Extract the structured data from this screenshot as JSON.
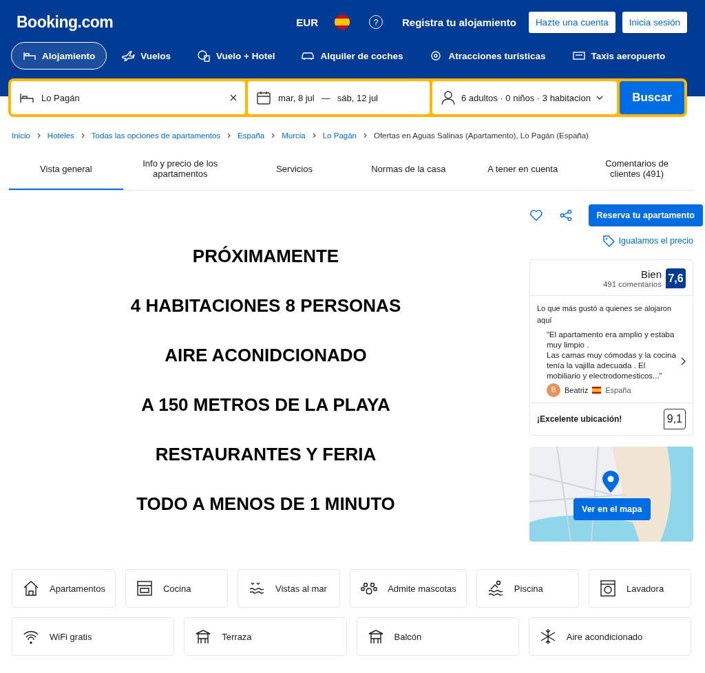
{
  "header": {
    "logo": "Booking.com",
    "currency": "EUR",
    "help": "?",
    "register_link": "Registra tu alojamiento",
    "buttons": [
      "Hazte una cuenta",
      "Inicia sesión"
    ]
  },
  "nav": [
    {
      "label": "Alojamiento",
      "selected": true
    },
    {
      "label": "Vuelos",
      "selected": false
    },
    {
      "label": "Vuelo + Hotel",
      "selected": false
    },
    {
      "label": "Alquiler de coches",
      "selected": false
    },
    {
      "label": "Atracciones turísticas",
      "selected": false
    },
    {
      "label": "Taxis aeropuerto",
      "selected": false
    }
  ],
  "search": {
    "destination": "Lo Pagán",
    "check_in": "mar, 8 jul",
    "dash": "—",
    "check_out": "sáb, 12 jul",
    "guests": "6 adultos · 0 niños · 3 habitacion",
    "button": "Buscar"
  },
  "breadcrumb": {
    "links": [
      "Inicio",
      "Hoteles",
      "Todas las opciones de apartamentos",
      "España",
      "Murcia",
      "Lo Pagán"
    ],
    "current": "Ofertas en Aguas Salinas (Apartamento), Lo Pagán (España)"
  },
  "tabs": [
    {
      "label": "Vista general",
      "selected": true
    },
    {
      "label": "Info y precio de los apartamentos",
      "selected": false
    },
    {
      "label": "Servicios",
      "selected": false
    },
    {
      "label": "Normas de la casa",
      "selected": false
    },
    {
      "label": "A tener en cuenta",
      "selected": false
    },
    {
      "label": "Comentarios de clientes (491)",
      "selected": false
    }
  ],
  "actions": {
    "reserve": "Reserva tu apartamento",
    "price_match": "Igualamos el precio"
  },
  "listing_image_text": [
    "PRÓXIMAMENTE",
    "4 HABITACIONES 8 PERSONAS",
    "AIRE ACONIDCIONADO",
    "A 150 METROS DE LA PLAYA",
    "RESTAURANTES Y FERIA",
    "TODO A MENOS DE 1 MINUTO"
  ],
  "review": {
    "rating_word": "Bien",
    "count": "491 comentarios",
    "score": "7,6",
    "heading": "Lo que más gustó a quienes se alojaron aquí",
    "quote": "“El apartamento era amplio y estaba muy limpio .\nLas camas muy cómodas y la cocina tenía la vajilla adecuada . El mobiliario y electrodomesticos...”",
    "avatar": "B",
    "reviewer": "Beatriz",
    "country": "España",
    "location_label": "¡Excelente ubicación!",
    "location_score": "9,1"
  },
  "map": {
    "button": "Ver en el mapa"
  },
  "amenities": [
    [
      "Apartamentos",
      "Cocina",
      "Vistas al mar",
      "Admite mascotas",
      "Piscina",
      "Lavadora"
    ],
    [
      "WiFi gratis",
      "Terraza",
      "Balcón",
      "Aire acondicionado"
    ]
  ]
}
